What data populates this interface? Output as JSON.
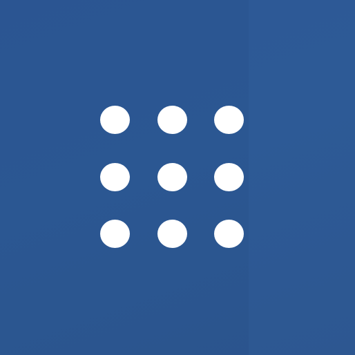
{
  "icon": {
    "name": "app-grid-icon",
    "background_color": "#2d5896",
    "dot_color": "#ffffff",
    "rows": 3,
    "columns": 3
  }
}
